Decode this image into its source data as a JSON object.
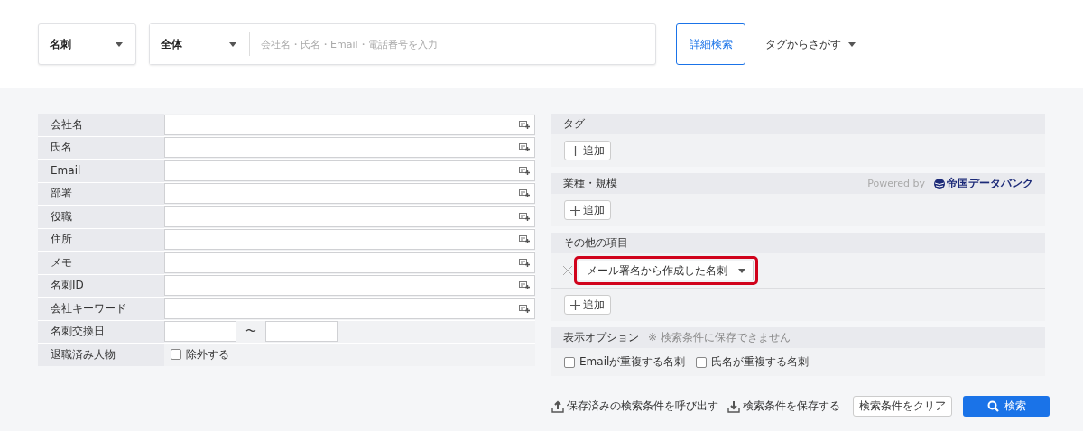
{
  "top_bar": {
    "type_select": {
      "value": "名刺"
    },
    "scope_select": {
      "value": "全体"
    },
    "search": {
      "placeholder": "会社名・氏名・Email・電話番号を入力"
    },
    "advanced_button": "詳細検索",
    "tag_menu": "タグからさがす"
  },
  "fields": [
    {
      "label": "会社名",
      "kind": "text"
    },
    {
      "label": "氏名",
      "kind": "text"
    },
    {
      "label": "Email",
      "kind": "text"
    },
    {
      "label": "部署",
      "kind": "text"
    },
    {
      "label": "役職",
      "kind": "text"
    },
    {
      "label": "住所",
      "kind": "text"
    },
    {
      "label": "メモ",
      "kind": "text"
    },
    {
      "label": "名刺ID",
      "kind": "text"
    },
    {
      "label": "会社キーワード",
      "kind": "text"
    },
    {
      "label": "名刺交換日",
      "kind": "date_range",
      "separator": "〜"
    },
    {
      "label": "退職済み人物",
      "kind": "checkbox",
      "option": "除外する",
      "checked": false
    }
  ],
  "sections": [
    {
      "title": "タグ",
      "kind": "add",
      "add_button": "追加"
    },
    {
      "title": "業種・規模",
      "kind": "add",
      "powered_by": "Powered by",
      "logo_text": "帝国データバンク",
      "add_button": "追加"
    },
    {
      "title": "その他の項目",
      "kind": "conditions",
      "conditions": [
        {
          "value": "メール署名から作成した名刺",
          "highlighted": true
        }
      ],
      "add_button": "追加"
    },
    {
      "title": "表示オプション",
      "note": "※ 検索条件に保存できません",
      "kind": "options",
      "options": [
        {
          "label": "Emailが重複する名刺",
          "checked": false
        },
        {
          "label": "氏名が重複する名刺",
          "checked": false
        }
      ]
    }
  ],
  "footer": {
    "load_link": "保存済みの検索条件を呼び出す",
    "save_link": "検索条件を保存する",
    "clear_button": "検索条件をクリア",
    "search_button": "検索"
  }
}
